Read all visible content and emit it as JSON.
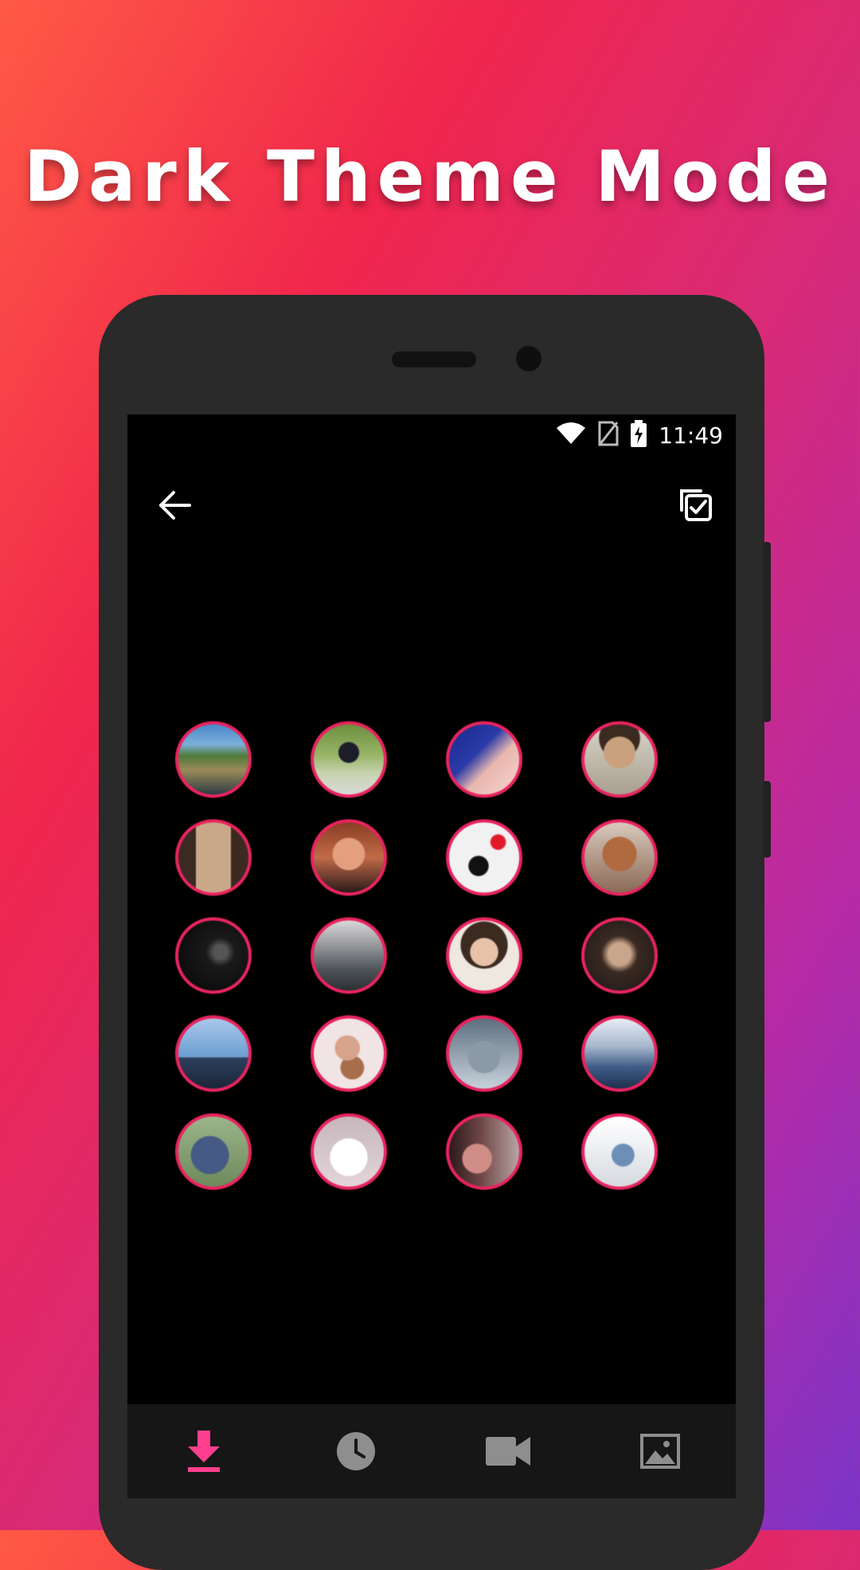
{
  "headline": "Dark Theme Mode",
  "status_bar": {
    "time": "11:49",
    "wifi_icon": "wifi-icon",
    "sim_icon": "no-sim-icon",
    "battery_icon": "battery-charging-icon"
  },
  "toolbar": {
    "back_icon": "arrow-left-icon",
    "select_icon": "select-all-icon"
  },
  "colors": {
    "accent": "#e8245f",
    "nav_active": "#ff3f8e",
    "nav_inactive": "#8e8e8e",
    "screen_bg": "#000000"
  },
  "avatars": [
    {
      "label": "landscape-lake"
    },
    {
      "label": "woman-outdoors"
    },
    {
      "label": "face-closeup"
    },
    {
      "label": "man-portrait"
    },
    {
      "label": "person-in-alley"
    },
    {
      "label": "woman-selfie"
    },
    {
      "label": "girl-balloon-art"
    },
    {
      "label": "person-with-horse"
    },
    {
      "label": "dark-photo"
    },
    {
      "label": "city-rooftops"
    },
    {
      "label": "woman-portrait"
    },
    {
      "label": "bearded-man"
    },
    {
      "label": "couple-by-sea"
    },
    {
      "label": "girl-sunglasses"
    },
    {
      "label": "man-with-cat"
    },
    {
      "label": "city-skyline"
    },
    {
      "label": "man-with-bag"
    },
    {
      "label": "white-dog"
    },
    {
      "label": "woman-profile"
    },
    {
      "label": "person-sitting"
    }
  ],
  "bottom_nav": [
    {
      "icon": "download-icon",
      "active": true
    },
    {
      "icon": "clock-icon",
      "active": false
    },
    {
      "icon": "video-icon",
      "active": false
    },
    {
      "icon": "image-icon",
      "active": false
    }
  ]
}
